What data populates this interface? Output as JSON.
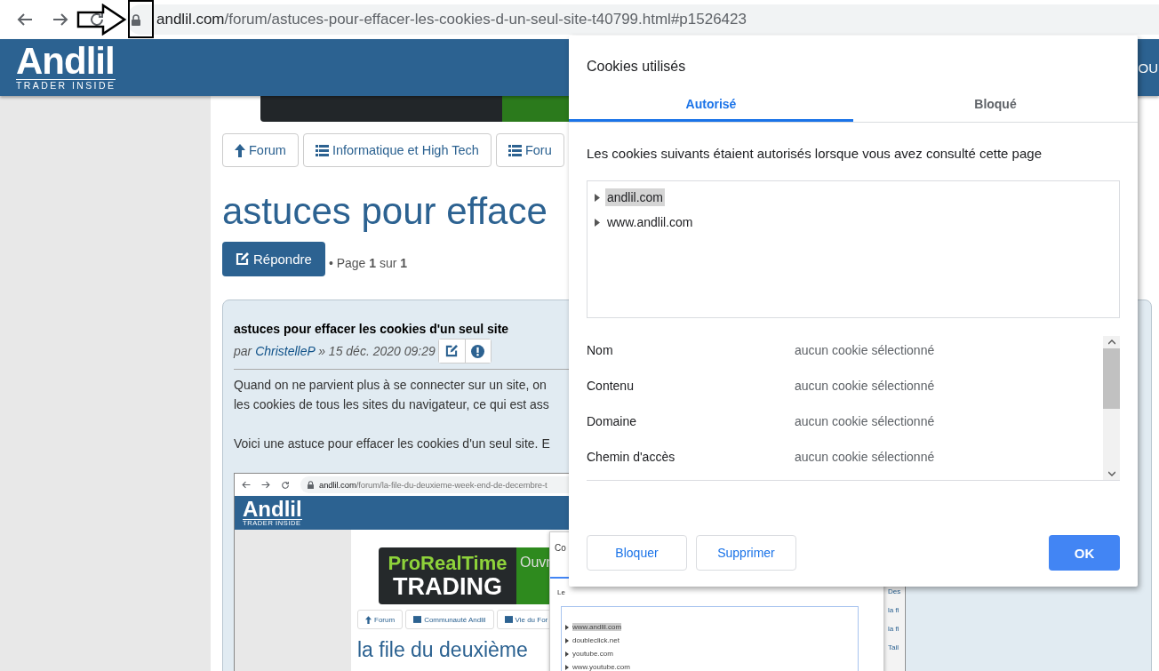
{
  "browser": {
    "url_domain": "andlil.com",
    "url_path": "/forum/astuces-pour-effacer-les-cookies-d-un-seul-site-t40799.html#p1526423"
  },
  "site_header": {
    "logo": "Andlil",
    "tagline": "TRADER INSIDE",
    "menu_fragment": "OU"
  },
  "breadcrumbs": [
    {
      "label": "Forum",
      "kind": "up"
    },
    {
      "label": "Informatique et High Tech",
      "kind": "list"
    },
    {
      "label": "Foru",
      "kind": "list"
    }
  ],
  "topic_title": "astuces pour efface",
  "reply_button": "Répondre",
  "pagination": "• Page **1** sur **1**",
  "post": {
    "title": "astuces pour effacer les cookies d'un seul site",
    "author_prefix": "par",
    "author": "ChristelleP",
    "date": "» 15 déc. 2020 09:29",
    "paragraphs": [
      {
        "lines": [
          "Quand on ne parvient plus à se connecter sur un site, on",
          "les cookies de tous les sites du navigateur, ce qui est ass"
        ]
      },
      {
        "lines": [
          "Voici une astuce pour effacer les cookies d'un seul site. E"
        ]
      }
    ]
  },
  "embedded_screenshot": {
    "url_domain": "andlil.com",
    "url_path": "/forum/la-file-du-deuxieme-week-end-de-decembre-t",
    "logo": "Andlil",
    "tagline": "TRADER INSIDE",
    "banner_lines": [
      "ProRealTime",
      "TRADING"
    ],
    "banner_cta": "Ouvr",
    "nav": [
      {
        "label": "Forum",
        "kind": "up"
      },
      {
        "label": "Communauté Andlil",
        "kind": "list"
      },
      {
        "label": "Vie du For",
        "kind": "list"
      }
    ],
    "heading": "la file du deuxième",
    "dialog_title": "Co",
    "dialog_text": "Le",
    "sites": [
      {
        "label": "www.andlil.com",
        "selected": true
      },
      {
        "label": "doubleclick.net",
        "selected": false
      },
      {
        "label": "youtube.com",
        "selected": false
      },
      {
        "label": "www.youtube.com",
        "selected": false
      }
    ],
    "sidebar_links": [
      "Des",
      "la fi",
      "la fi",
      "Tail"
    ]
  },
  "cookie_dialog": {
    "title": "Cookies utilisés",
    "tabs": [
      {
        "label": "Autorisé",
        "selected": true
      },
      {
        "label": "Bloqué",
        "selected": false
      }
    ],
    "description": "Les cookies suivants étaient autorisés lorsque vous avez consulté cette page",
    "sites": [
      {
        "label": "andlil.com",
        "selected": true,
        "expanded": false
      },
      {
        "label": "www.andlil.com",
        "selected": false,
        "expanded": false
      }
    ],
    "details": [
      {
        "label": "Nom",
        "value": "aucun cookie sélectionné"
      },
      {
        "label": "Contenu",
        "value": "aucun cookie sélectionné"
      },
      {
        "label": "Domaine",
        "value": "aucun cookie sélectionné"
      },
      {
        "label": "Chemin d'accès",
        "value": "aucun cookie sélectionné"
      }
    ],
    "buttons": [
      {
        "label": "Bloquer",
        "kind": "secondary"
      },
      {
        "label": "Supprimer",
        "kind": "secondary"
      },
      {
        "label": "OK",
        "kind": "primary"
      }
    ]
  }
}
